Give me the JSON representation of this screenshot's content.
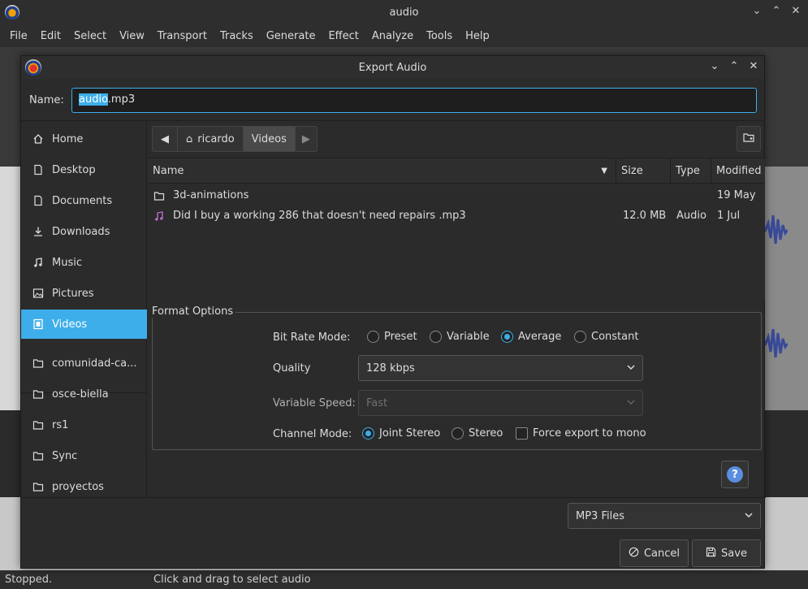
{
  "app": {
    "title": "audio",
    "menu": [
      "File",
      "Edit",
      "Select",
      "View",
      "Transport",
      "Tracks",
      "Generate",
      "Effect",
      "Analyze",
      "Tools",
      "Help"
    ],
    "status_left": "Stopped.",
    "status_hint": "Click and drag to select audio"
  },
  "dialog": {
    "title": "Export Audio",
    "name_label": "Name:",
    "name_selected": "audio",
    "name_rest": ".mp3",
    "places": [
      {
        "label": "Home",
        "icon": "home-icon"
      },
      {
        "label": "Desktop",
        "icon": "desktop-icon"
      },
      {
        "label": "Documents",
        "icon": "document-icon"
      },
      {
        "label": "Downloads",
        "icon": "download-icon"
      },
      {
        "label": "Music",
        "icon": "music-icon"
      },
      {
        "label": "Pictures",
        "icon": "picture-icon"
      },
      {
        "label": "Videos",
        "icon": "video-icon",
        "active": true
      },
      {
        "label": "comunidad-ca...",
        "icon": "folder-icon"
      },
      {
        "label": "osce-biella",
        "icon": "folder-icon"
      },
      {
        "label": "rs1",
        "icon": "folder-icon"
      },
      {
        "label": "Sync",
        "icon": "folder-icon"
      },
      {
        "label": "proyectos",
        "icon": "folder-icon"
      }
    ],
    "path": [
      "ricardo",
      "Videos"
    ],
    "columns": {
      "name": "Name",
      "size": "Size",
      "type": "Type",
      "modified": "Modified"
    },
    "files": [
      {
        "name": "3d-animations",
        "size": "",
        "type": "",
        "modified": "19 May",
        "icon": "folder-icon"
      },
      {
        "name": "Did I buy a working 286 that doesn't need repairs .mp3",
        "size": "12.0 MB",
        "type": "Audio",
        "modified": "1 Jul",
        "icon": "music-icon"
      }
    ],
    "format_options": {
      "title": "Format Options",
      "bit_rate_label": "Bit Rate Mode:",
      "bit_rate_modes": [
        "Preset",
        "Variable",
        "Average",
        "Constant"
      ],
      "bit_rate_selected": "Average",
      "quality_label": "Quality",
      "quality_value": "128 kbps",
      "variable_speed_label": "Variable Speed:",
      "variable_speed_value": "Fast",
      "channel_label": "Channel Mode:",
      "channel_modes": [
        "Joint Stereo",
        "Stereo"
      ],
      "channel_selected": "Joint Stereo",
      "force_mono_label": "Force export to mono"
    },
    "file_type": "MP3 Files",
    "cancel_label": "Cancel",
    "save_label": "Save",
    "accent": "#3daee9"
  }
}
